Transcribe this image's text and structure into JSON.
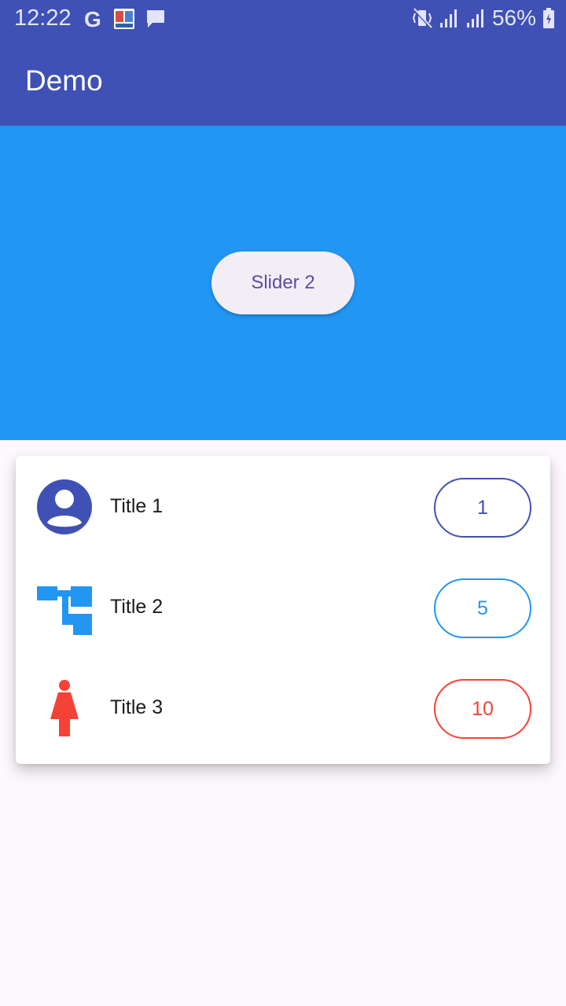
{
  "status_bar": {
    "time": "12:22",
    "battery": "56%",
    "icons_left": [
      "google-icon",
      "news-app-icon",
      "message-icon"
    ],
    "icons_right": [
      "vibrate-icon",
      "signal-icon",
      "signal-icon",
      "battery-charging-icon"
    ]
  },
  "app_bar": {
    "title": "Demo"
  },
  "slider": {
    "button_label": "Slider 2",
    "background_color": "#2196f3"
  },
  "list": {
    "items": [
      {
        "title": "Title 1",
        "count": "1",
        "icon": "account-circle-icon",
        "color": "#3f51b5"
      },
      {
        "title": "Title 2",
        "count": "5",
        "icon": "account-tree-icon",
        "color": "#2196f3"
      },
      {
        "title": "Title 3",
        "count": "10",
        "icon": "woman-icon",
        "color": "#f44336"
      }
    ]
  },
  "colors": {
    "primary": "#3f51b5",
    "background": "#fdf8fd"
  }
}
